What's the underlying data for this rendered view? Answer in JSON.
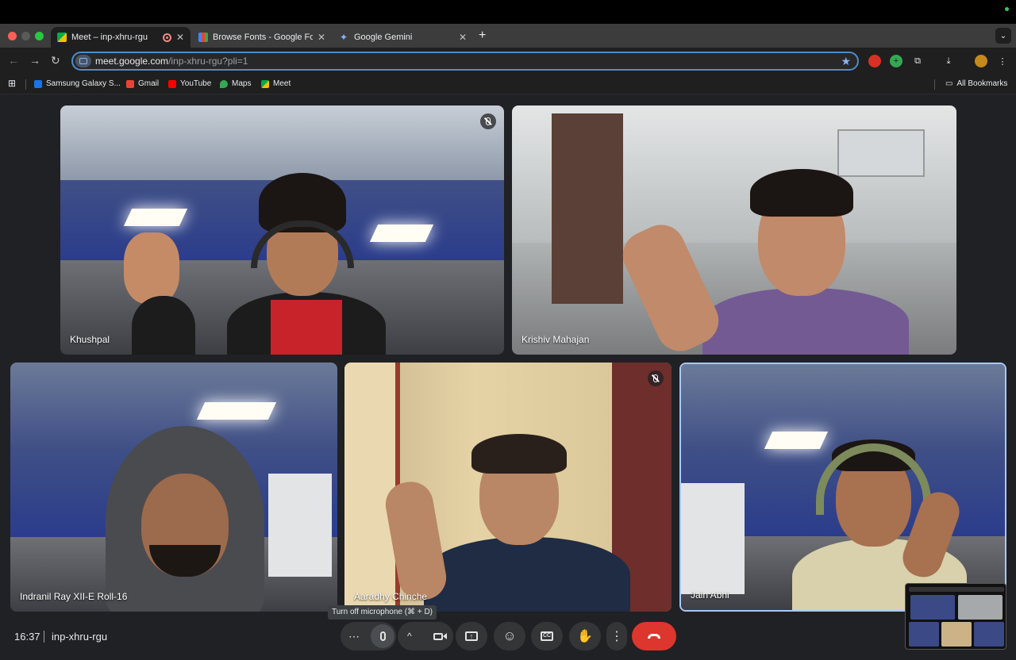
{
  "browser": {
    "tabs": [
      {
        "label": "Meet – inp-xhru-rgu",
        "active": true,
        "icon": "meet-icon"
      },
      {
        "label": "Browse Fonts - Google Fonts",
        "active": false,
        "icon": "google-fonts-icon"
      },
      {
        "label": "Google Gemini",
        "active": false,
        "icon": "gemini-icon"
      }
    ],
    "url_host": "meet.google.com",
    "url_path": "/inp-xhru-rgu?pli=1",
    "bookmarks": [
      {
        "label": "Samsung Galaxy S...",
        "icon": "samsung-icon"
      },
      {
        "label": "Gmail",
        "icon": "gmail-icon"
      },
      {
        "label": "YouTube",
        "icon": "youtube-icon"
      },
      {
        "label": "Maps",
        "icon": "maps-icon"
      },
      {
        "label": "Meet",
        "icon": "meet-icon"
      }
    ],
    "all_bookmarks": "All Bookmarks"
  },
  "meeting": {
    "participants": [
      {
        "name": "Khushpal",
        "muted": true
      },
      {
        "name": "Krishiv Mahajan",
        "muted": false
      },
      {
        "name": "Indranil Ray XII-E Roll-16",
        "muted": false
      },
      {
        "name": "Aaradhy Chinche",
        "muted": true
      },
      {
        "name": "Jain Abhi",
        "muted": false,
        "speaking": true
      }
    ],
    "time": "16:37",
    "code": "inp-xhru-rgu",
    "tooltip": "Turn off microphone (⌘ + D)"
  },
  "controls": [
    {
      "name": "more-audio-options",
      "icon": "⋯"
    },
    {
      "name": "microphone",
      "icon": "mic-icon"
    },
    {
      "name": "camera",
      "icon": "video-icon"
    },
    {
      "name": "present-screen",
      "icon": "present-icon"
    },
    {
      "name": "reactions",
      "icon": "emoji-icon"
    },
    {
      "name": "captions",
      "icon": "cc-icon"
    },
    {
      "name": "raise-hand",
      "icon": "hand-icon"
    },
    {
      "name": "more-options",
      "icon": "more-vert-icon"
    },
    {
      "name": "leave-call",
      "icon": "end-call-icon"
    }
  ],
  "colors": {
    "accent": "#8ab4f8",
    "end_call": "#dc362e",
    "background": "#202124"
  }
}
